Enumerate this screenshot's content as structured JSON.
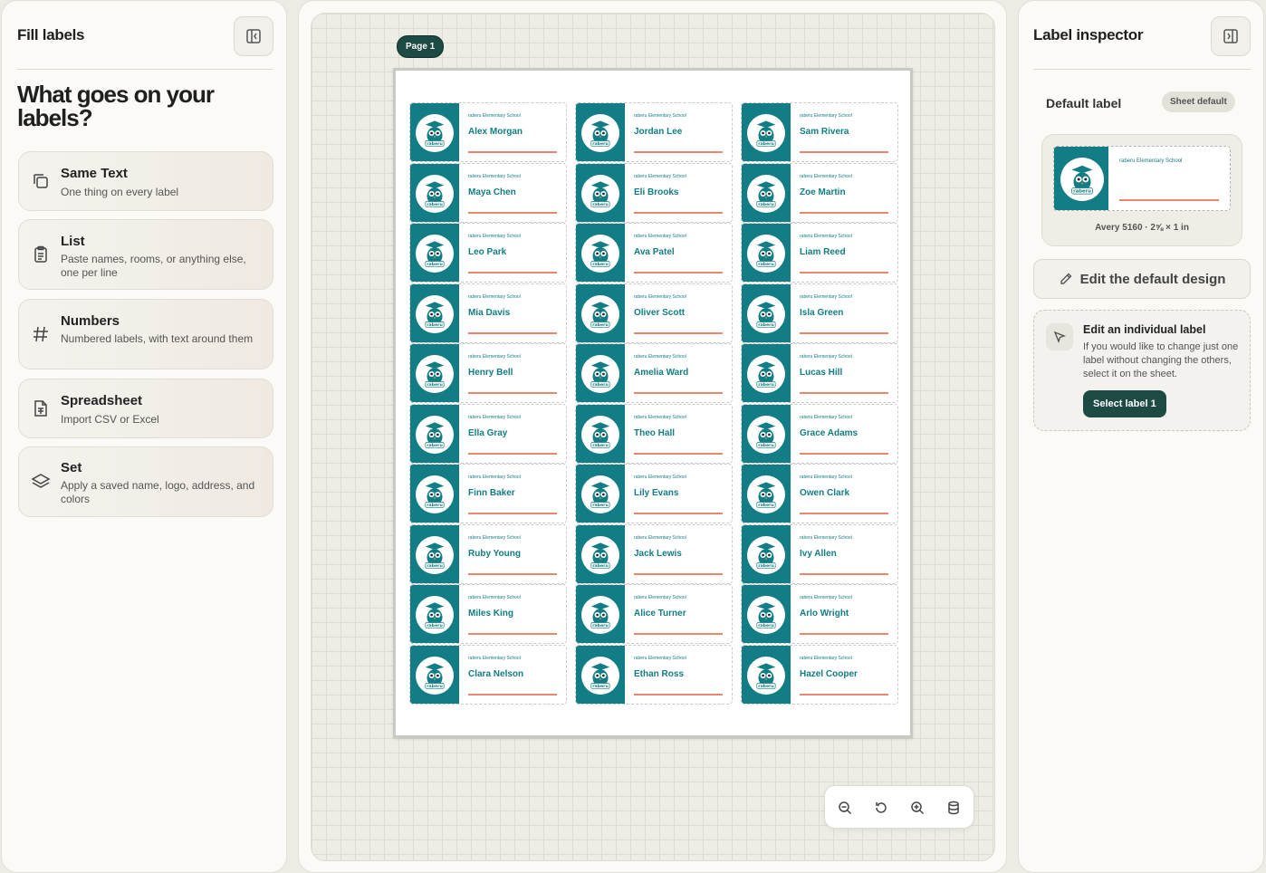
{
  "left_panel": {
    "title": "Fill labels",
    "headline": "What goes on your labels?",
    "options": [
      {
        "title": "Same Text",
        "description": "One thing on every label",
        "icon": "copy-icon"
      },
      {
        "title": "List",
        "description": "Paste names, rooms, or anything else, one per line",
        "icon": "clipboard-list-icon"
      },
      {
        "title": "Numbers",
        "description": "Numbered labels, with text around them",
        "icon": "hash-icon"
      },
      {
        "title": "Spreadsheet",
        "description": "Import CSV or Excel",
        "icon": "spreadsheet-file-icon"
      },
      {
        "title": "Set",
        "description": "Apply a saved name, logo, address, and colors",
        "icon": "layers-icon"
      }
    ]
  },
  "canvas": {
    "page_badge": "Page 1",
    "school_name": "raberu Elementary School",
    "logo_text": "raberu",
    "names": [
      "Alex Morgan",
      "Jordan Lee",
      "Sam Rivera",
      "Maya Chen",
      "Eli Brooks",
      "Zoe Martin",
      "Leo Park",
      "Ava Patel",
      "Liam Reed",
      "Mia Davis",
      "Oliver Scott",
      "Isla Green",
      "Henry Bell",
      "Amelia Ward",
      "Lucas Hill",
      "Ella Gray",
      "Theo Hall",
      "Grace Adams",
      "Finn Baker",
      "Lily Evans",
      "Owen Clark",
      "Ruby Young",
      "Jack Lewis",
      "Ivy Allen",
      "Miles King",
      "Alice Turner",
      "Arlo Wright",
      "Clara Nelson",
      "Ethan Ross",
      "Hazel Cooper"
    ],
    "colors": {
      "band": "#127d84",
      "line": "#e8876c",
      "accent_dark": "#1d4a43"
    }
  },
  "right_panel": {
    "title": "Label inspector",
    "default_label_title": "Default label",
    "sheet_default_badge": "Sheet default",
    "preview_school": "raberu Elementary School",
    "preview_caption": "Avery 5160 · 2⅝ × 1 in",
    "edit_default_button": "Edit the default design",
    "individual_title": "Edit an individual label",
    "individual_desc": "If you would like to change just one label without changing the others, select it on the sheet.",
    "select_button": "Select label 1"
  }
}
